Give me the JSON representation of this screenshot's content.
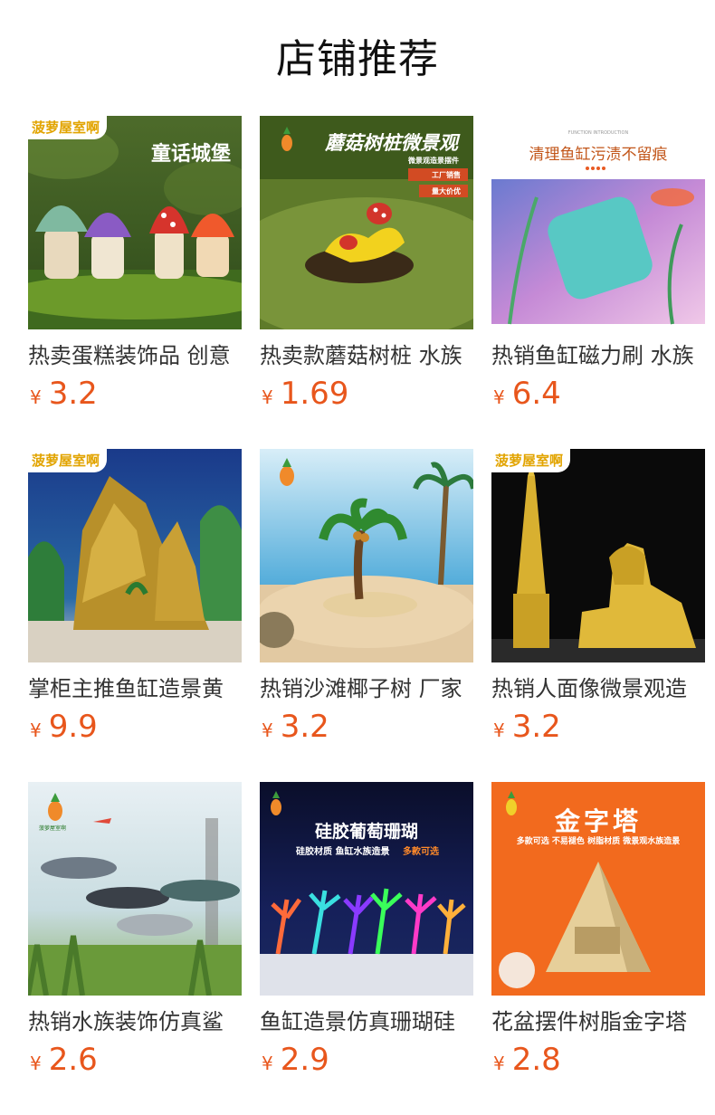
{
  "header": {
    "title": "店铺推荐"
  },
  "colors": {
    "price": "#e8561c",
    "title_text": "#333333",
    "brand_tag": "#e2a400"
  },
  "products": [
    {
      "title": "热卖蛋糕装饰品 创意",
      "currency": "¥",
      "price": "3.2",
      "image": {
        "tag": "菠萝屋室啊",
        "caption": "童话城堡"
      }
    },
    {
      "title": "热卖款蘑菇树桩 水族",
      "currency": "¥",
      "price": "1.69",
      "image": {
        "caption": "蘑菇树桩微景观",
        "sub1": "微景观造景摆件",
        "sub2": "工厂销售",
        "sub3": "量大价优"
      }
    },
    {
      "title": "热销鱼缸磁力刷 水族",
      "currency": "¥",
      "price": "6.4",
      "image": {
        "top": "FUNCTION INTRODUCTION",
        "caption": "清理鱼缸污渍不留痕"
      }
    },
    {
      "title": "掌柜主推鱼缸造景黄",
      "currency": "¥",
      "price": "9.9",
      "image": {
        "tag": "菠萝屋室啊"
      }
    },
    {
      "title": "热销沙滩椰子树 厂家",
      "currency": "¥",
      "price": "3.2",
      "image": {}
    },
    {
      "title": "热销人面像微景观造",
      "currency": "¥",
      "price": "3.2",
      "image": {
        "tag": "菠萝屋室啊"
      }
    },
    {
      "title": "热销水族装饰仿真鲨",
      "currency": "¥",
      "price": "2.6",
      "image": {
        "logo_text": "菠萝屋室啊"
      }
    },
    {
      "title": "鱼缸造景仿真珊瑚硅",
      "currency": "¥",
      "price": "2.9",
      "image": {
        "caption": "硅胶葡萄珊瑚",
        "sub1": "硅胶材质 鱼缸水族造景",
        "sub2": "多款可选"
      }
    },
    {
      "title": "花盆摆件树脂金字塔",
      "currency": "¥",
      "price": "2.8",
      "image": {
        "caption": "金字塔",
        "sub1": "多款可选 不易褪色 树脂材质 微景观水族造景"
      }
    }
  ]
}
